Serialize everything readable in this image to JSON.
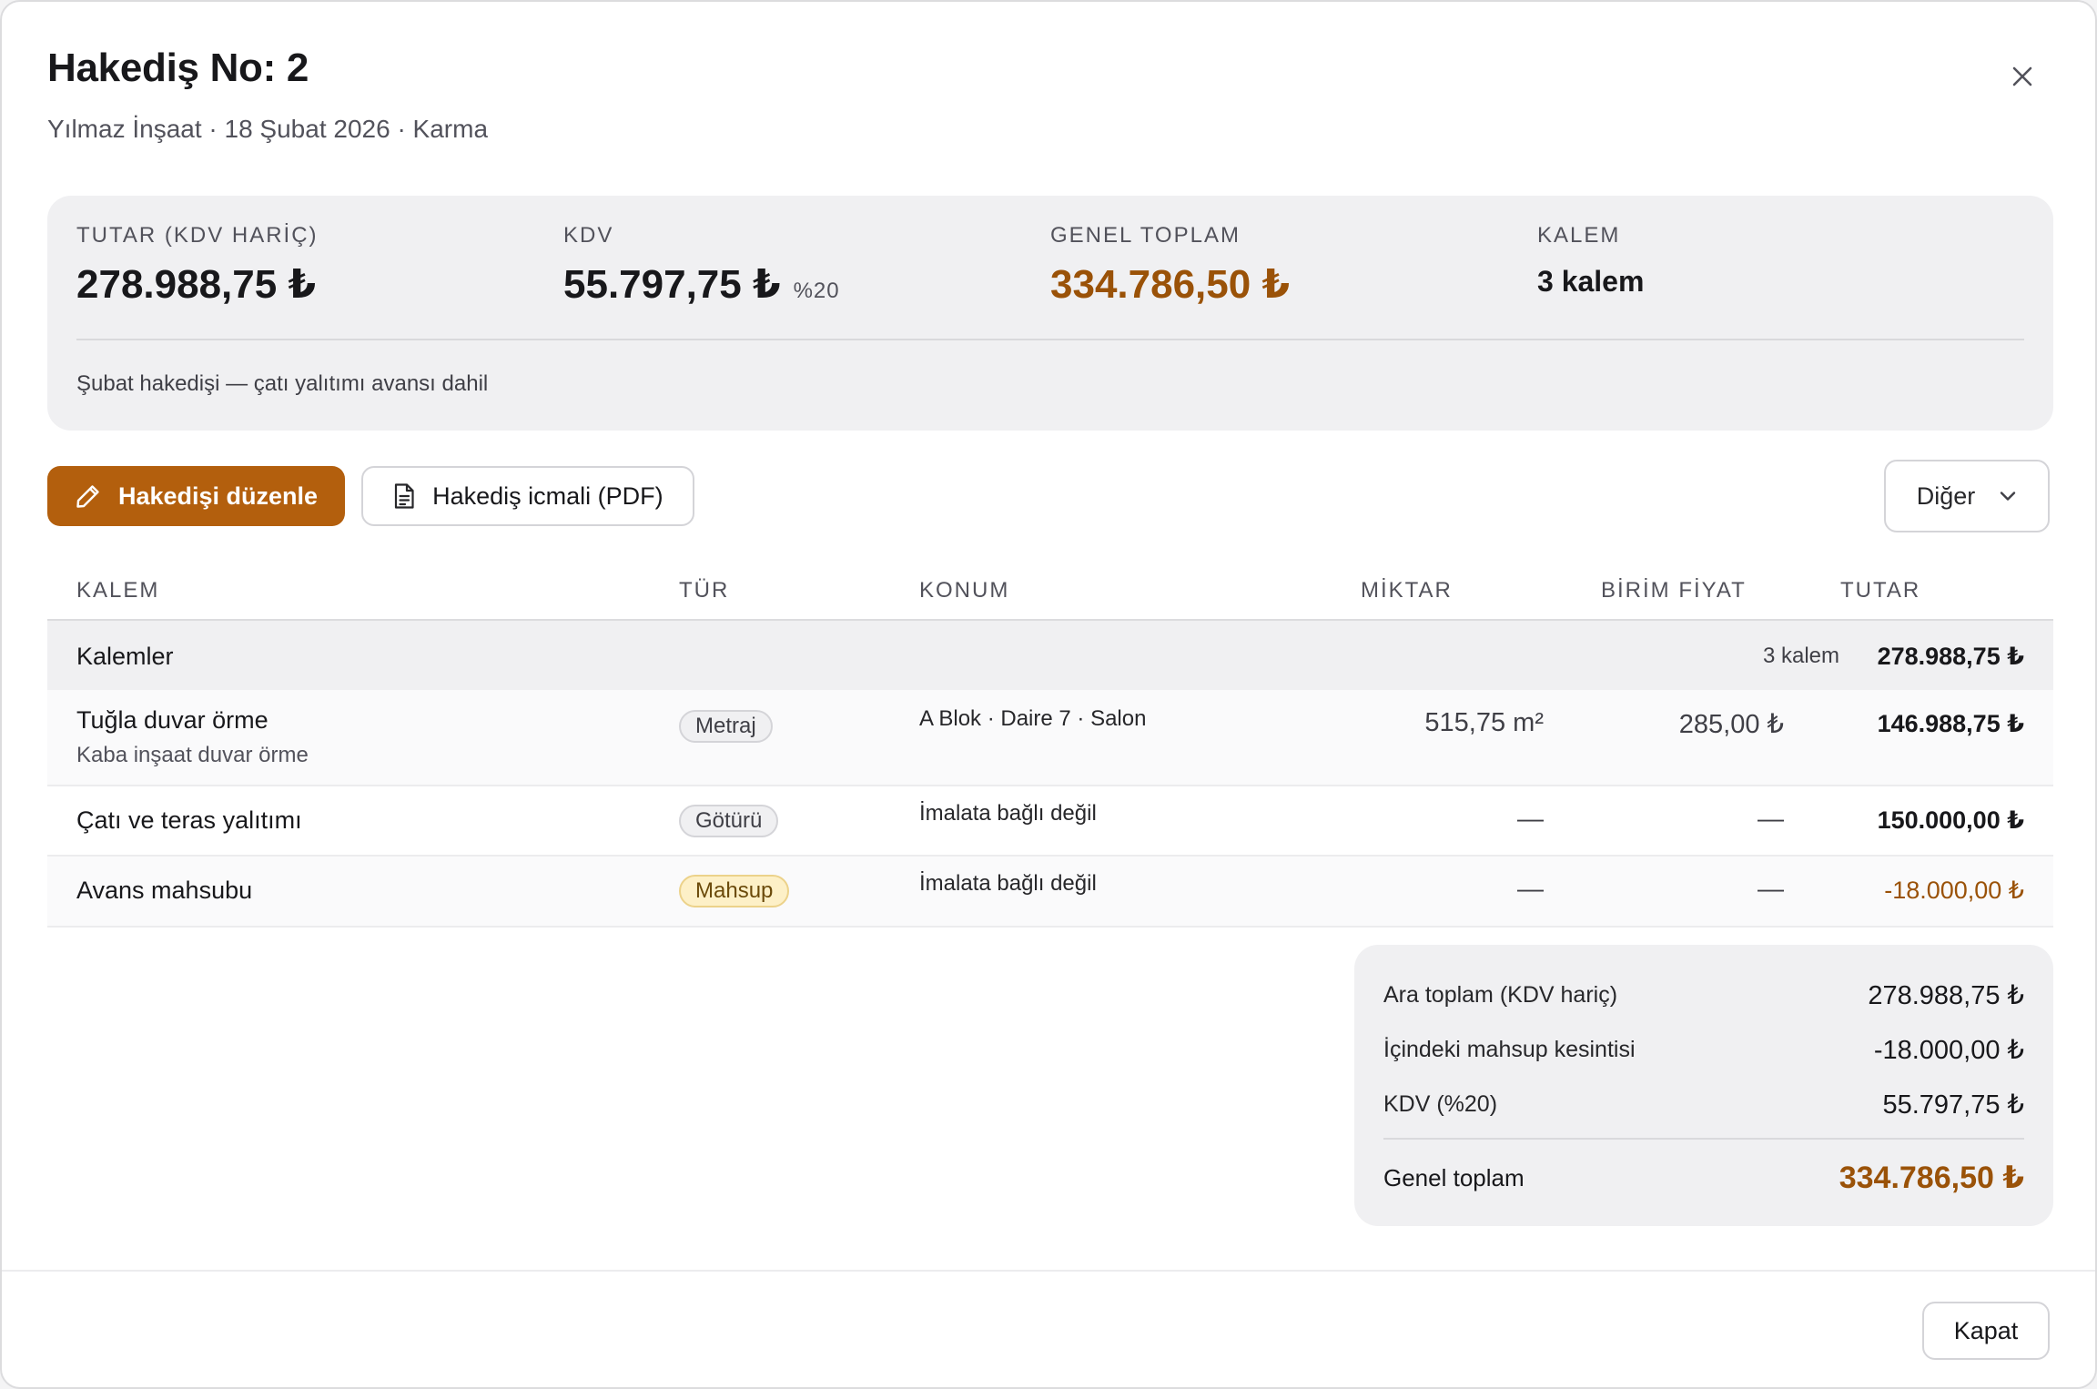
{
  "dialog": {
    "title": "Hakediş No: 2",
    "subtitle": "Yılmaz İnşaat · 18 Şubat 2026 · Karma",
    "close_icon": "close-icon"
  },
  "summary": {
    "stats": [
      {
        "label": "TUTAR (KDV HARİÇ)",
        "value": "278.988,75 ₺"
      },
      {
        "label": "KDV",
        "value": "55.797,75 ₺",
        "suffix": "%20"
      },
      {
        "label": "GENEL TOPLAM",
        "value": "334.786,50 ₺"
      },
      {
        "label": "KALEM",
        "value": "3 kalem"
      }
    ],
    "note": "Şubat hakedişi — çatı yalıtımı avansı dahil"
  },
  "actions": {
    "edit_label": "Hakedişi düzenle",
    "pdf_label": "Hakediş icmali (PDF)",
    "more_label": "Diğer"
  },
  "table": {
    "headers": {
      "name": "KALEM",
      "type": "TÜR",
      "location": "KONUM",
      "quantity": "MİKTAR",
      "unit_price": "BİRİM FİYAT",
      "total": "TUTAR"
    },
    "group": {
      "label": "Kalemler",
      "count": "3 kalem",
      "total": "278.988,75 ₺"
    },
    "rows": [
      {
        "name": "Tuğla duvar örme",
        "description": "Kaba inşaat duvar örme",
        "type": "Metraj",
        "location": "A Blok · Daire 7 · Salon",
        "quantity": "515,75 m²",
        "unit_price": "285,00 ₺",
        "total": "146.988,75 ₺"
      },
      {
        "name": "Çatı ve teras yalıtımı",
        "type": "Götürü",
        "location": "İmalata bağlı değil",
        "quantity": "—",
        "unit_price": "—",
        "total": "150.000,00 ₺"
      },
      {
        "name": "Avans mahsubu",
        "type": "Mahsup",
        "location": "İmalata bağlı değil",
        "quantity": "—",
        "unit_price": "—",
        "total": "-18.000,00 ₺"
      }
    ]
  },
  "totals": {
    "subtotal_label": "Ara toplam (KDV hariç)",
    "subtotal_value": "278.988,75 ₺",
    "deduction_label": "İçindeki mahsup kesintisi",
    "deduction_value": "-18.000,00 ₺",
    "vat_label": "KDV (%20)",
    "vat_value": "55.797,75 ₺",
    "grand_label": "Genel toplam",
    "grand_value": "334.786,50 ₺"
  },
  "footer": {
    "close_label": "Kapat"
  },
  "colors": {
    "accent": "#b35f0d",
    "accent_text": "#9a5208",
    "panel": "#f0f0f2"
  }
}
